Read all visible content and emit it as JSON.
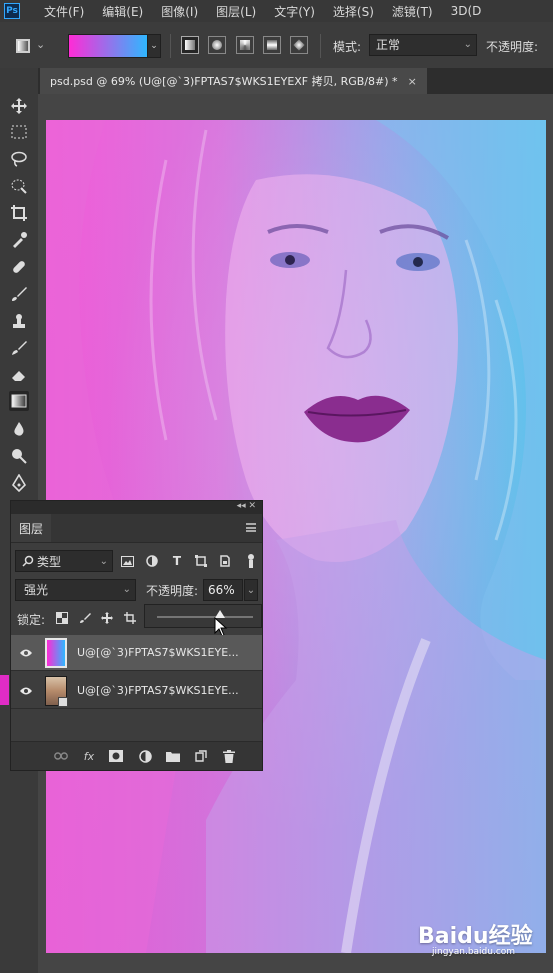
{
  "app": {
    "logo": "Ps"
  },
  "menu": [
    "文件(F)",
    "编辑(E)",
    "图像(I)",
    "图层(L)",
    "文字(Y)",
    "选择(S)",
    "滤镜(T)",
    "3D(D"
  ],
  "options": {
    "mode_label": "模式:",
    "mode_value": "正常",
    "opacity_label": "不透明度:",
    "gradient_colors": [
      "#ff2bd6",
      "#2fb7ff"
    ]
  },
  "document": {
    "tab_title": "psd.psd @ 69% (U@[@`3)FPTAS7$WKS1EYEXF 拷贝, RGB/8#) *",
    "close_glyph": "×"
  },
  "layers_panel": {
    "tab_label": "图层",
    "filter_label": "类型",
    "blend_mode": "强光",
    "opacity_label": "不透明度:",
    "opacity_value": "66%",
    "opacity_slider": 0.66,
    "lock_label": "锁定:",
    "layers": [
      {
        "name": "U@[@`3)FPTAS7$WKS1EYE...",
        "thumb": "gradient",
        "visible": true,
        "active": true
      },
      {
        "name": "U@[@`3)FPTAS7$WKS1EYE...",
        "thumb": "photo",
        "visible": true,
        "active": false
      }
    ]
  },
  "watermark": {
    "text": "Baidu经验",
    "sub": "jingyan.baidu.com"
  }
}
